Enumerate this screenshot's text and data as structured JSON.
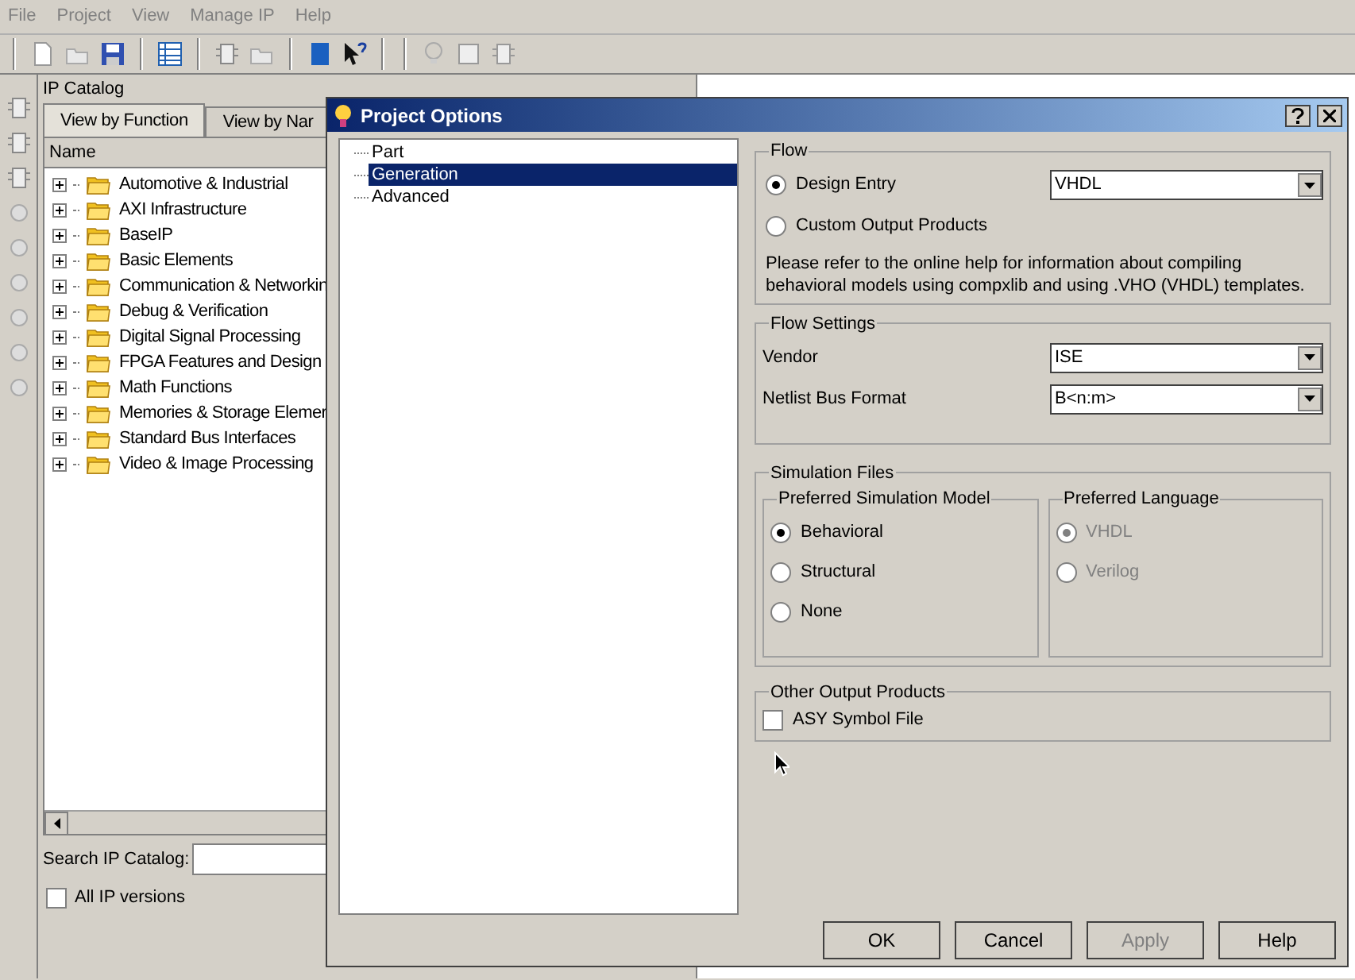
{
  "menu": [
    "File",
    "Project",
    "View",
    "Manage IP",
    "Help"
  ],
  "ip_catalog": {
    "title": "IP Catalog",
    "tabs": [
      {
        "label": "View by Function",
        "selected": true
      },
      {
        "label": "View by Nar",
        "selected": false
      }
    ],
    "column": "Name",
    "items": [
      {
        "label": "Automotive & Industrial",
        "expanded": false
      },
      {
        "label": "AXI Infrastructure",
        "expanded": false
      },
      {
        "label": "BaseIP",
        "expanded": false
      },
      {
        "label": "Basic Elements",
        "expanded": false
      },
      {
        "label": "Communication & Networkin",
        "expanded": false
      },
      {
        "label": "Debug & Verification",
        "expanded": false
      },
      {
        "label": "Digital Signal Processing",
        "expanded": false
      },
      {
        "label": "FPGA Features and Design",
        "expanded": false
      },
      {
        "label": "Math Functions",
        "expanded": false
      },
      {
        "label": "Memories & Storage Elemer",
        "expanded": false
      },
      {
        "label": "Standard Bus Interfaces",
        "expanded": false
      },
      {
        "label": "Video & Image Processing",
        "expanded": false
      }
    ],
    "search_label": "Search IP Catalog:",
    "all_versions": {
      "label": "All IP versions",
      "checked": false
    }
  },
  "dialog": {
    "title": "Project Options",
    "tree": [
      {
        "label": "Part",
        "selected": false
      },
      {
        "label": "Generation",
        "selected": true
      },
      {
        "label": "Advanced",
        "selected": false
      }
    ],
    "flow": {
      "title": "Flow",
      "options": [
        {
          "label": "Design Entry",
          "selected": true,
          "value": "VHDL"
        },
        {
          "label": "Custom Output Products",
          "selected": false
        }
      ],
      "note": "Please refer to the online help for information about compiling behavioral models using compxlib and using .VHO (VHDL) templates."
    },
    "flow_settings": {
      "title": "Flow Settings",
      "fields": [
        {
          "label": "Vendor",
          "value": "ISE"
        },
        {
          "label": "Netlist Bus Format",
          "value": "B<n:m>"
        }
      ]
    },
    "simulation_files": {
      "title": "Simulation Files",
      "groups": [
        {
          "title": "Preferred Simulation Model",
          "disabled": false,
          "options": [
            {
              "label": "Behavioral",
              "selected": true
            },
            {
              "label": "Structural",
              "selected": false
            },
            {
              "label": "None",
              "selected": false
            }
          ]
        },
        {
          "title": "Preferred Language",
          "disabled": true,
          "options": [
            {
              "label": "VHDL",
              "selected": true
            },
            {
              "label": "Verilog",
              "selected": false
            }
          ]
        }
      ]
    },
    "other_outputs": {
      "title": "Other Output Products",
      "checkboxes": [
        {
          "label": "ASY Symbol File",
          "checked": false
        }
      ]
    },
    "buttons": [
      {
        "label": "OK",
        "disabled": false
      },
      {
        "label": "Cancel",
        "disabled": false
      },
      {
        "label": "Apply",
        "disabled": true
      },
      {
        "label": "Help",
        "disabled": false
      }
    ]
  }
}
